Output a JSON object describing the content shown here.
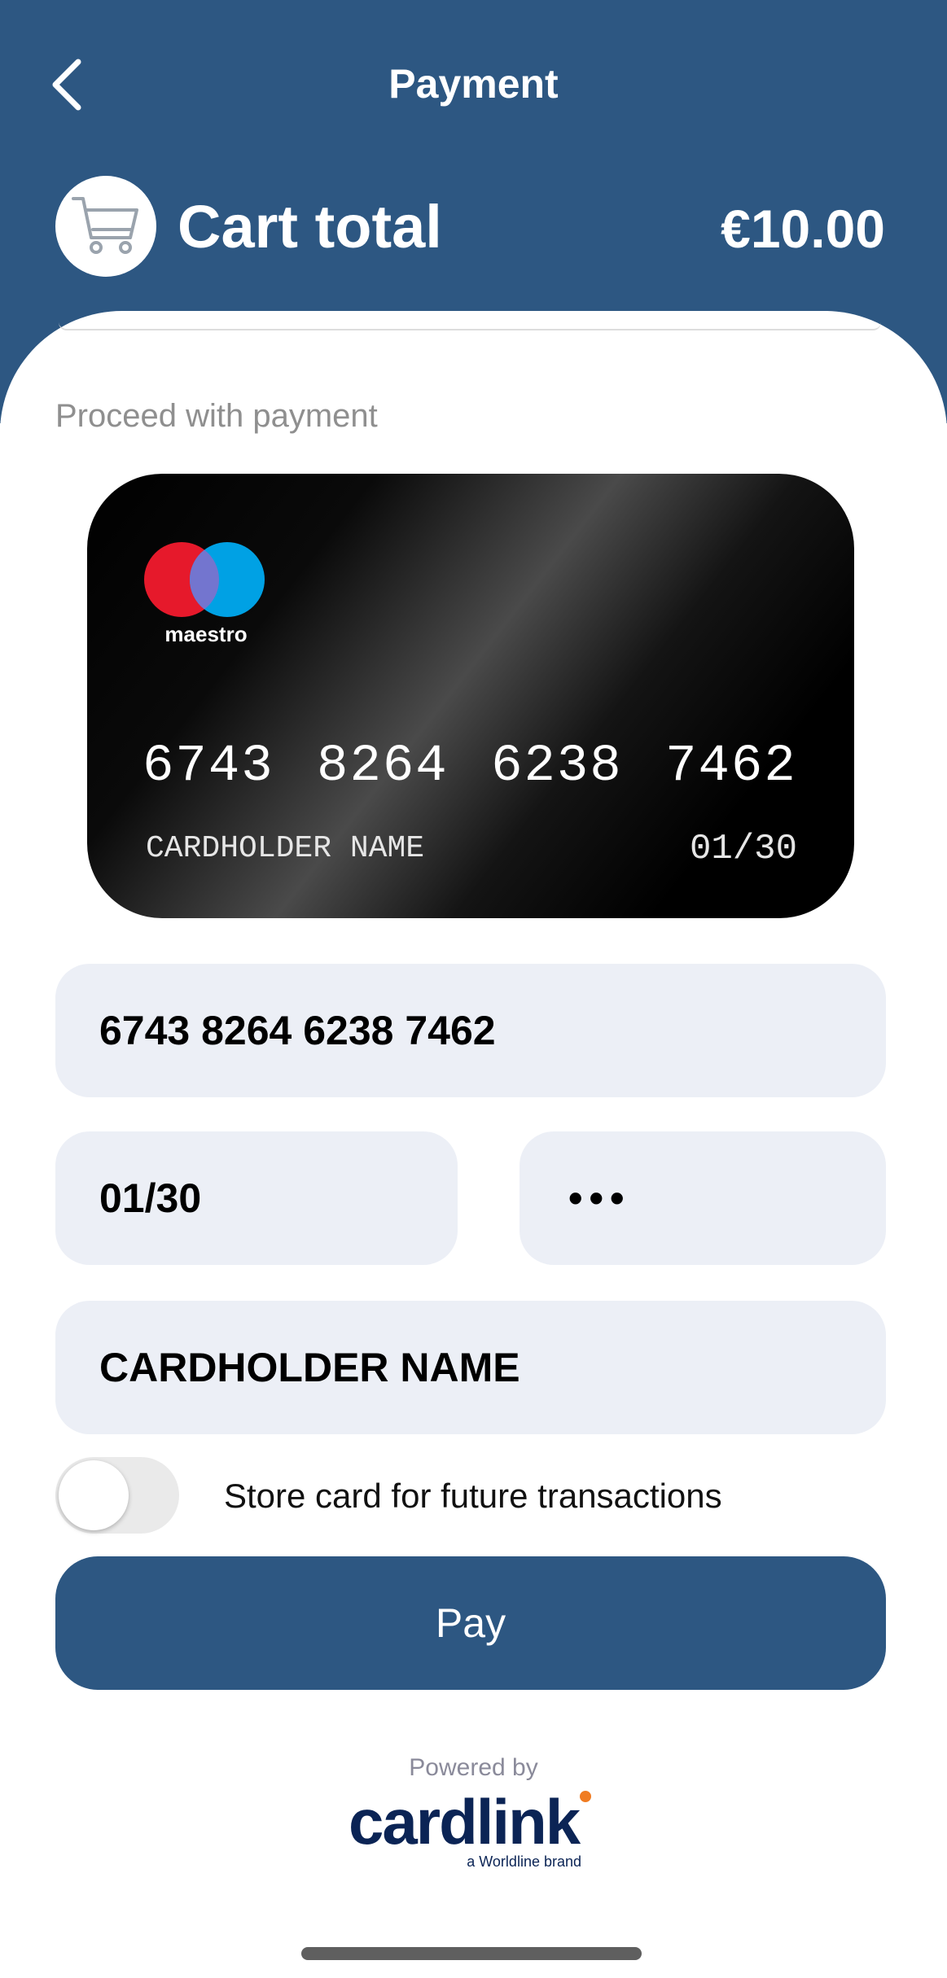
{
  "header": {
    "title": "Payment",
    "cart_total_label": "Cart total",
    "cart_total_amount": "€10.00"
  },
  "main": {
    "proceed_label": "Proceed with payment",
    "card_preview": {
      "brand": "maestro",
      "number": "6743 8264 6238 7462",
      "holder": "CARDHOLDER NAME",
      "expiry": "01/30"
    },
    "form": {
      "card_number_value": "6743 8264 6238 7462",
      "expiry_value": "01/30",
      "cvv_value": "•••",
      "name_value": "CARDHOLDER NAME"
    },
    "store_card": {
      "label": "Store card for future transactions",
      "enabled": false
    },
    "pay_label": "Pay"
  },
  "footer": {
    "powered_by": "Powered by",
    "brand_name": "cardlink",
    "brand_tagline": "a Worldline brand"
  },
  "icons": {
    "back": "chevron-left-icon",
    "cart": "cart-icon"
  },
  "colors": {
    "primary": "#2d5782",
    "field_bg": "#eceff6",
    "maestro_red": "#e6192b",
    "maestro_blue": "#00a1e4",
    "cardlink_navy": "#0b2455",
    "cardlink_orange": "#f07c22"
  }
}
